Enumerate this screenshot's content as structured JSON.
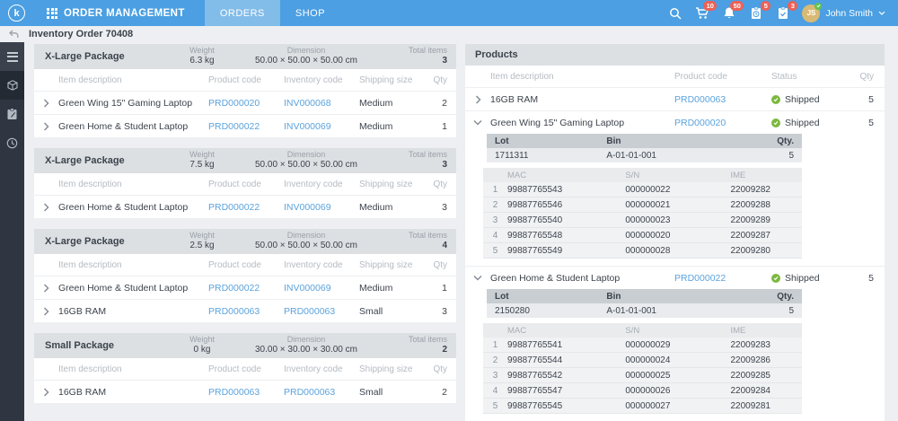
{
  "topbar": {
    "logo_text": "k",
    "app_title": "ORDER MANAGEMENT",
    "tabs": [
      {
        "label": "ORDERS"
      },
      {
        "label": "SHOP"
      }
    ],
    "badges": {
      "cart": "10",
      "notifications": "50",
      "tasks": "5",
      "approvals": "3"
    },
    "user": {
      "initials": "JS",
      "name": "John Smith"
    },
    "colors": {
      "bar": "#4b9fe2",
      "active_tab": "#82bce9",
      "badge": "#ec6156"
    }
  },
  "breadcrumb": {
    "title": "Inventory Order 70408"
  },
  "package_list": {
    "stat_labels": {
      "weight": "Weight",
      "dimension": "Dimension",
      "total_items": "Total items"
    },
    "columns": {
      "description": "Item description",
      "product_code": "Product code",
      "inventory_code": "Inventory code",
      "shipping_size": "Shipping size",
      "qty": "Qty"
    },
    "packages": [
      {
        "name": "X-Large Package",
        "weight": "6.3 kg",
        "dimension": "50.00 × 50.00 × 50.00 cm",
        "total_items": "3",
        "rows": [
          {
            "description": "Green Wing 15\" Gaming Laptop",
            "product_code": "PRD000020",
            "inventory_code": "INV000068",
            "shipping_size": "Medium",
            "qty": "2"
          },
          {
            "description": "Green Home & Student Laptop",
            "product_code": "PRD000022",
            "inventory_code": "INV000069",
            "shipping_size": "Medium",
            "qty": "1"
          }
        ]
      },
      {
        "name": "X-Large Package",
        "weight": "7.5 kg",
        "dimension": "50.00 × 50.00 × 50.00 cm",
        "total_items": "3",
        "rows": [
          {
            "description": "Green Home & Student Laptop",
            "product_code": "PRD000022",
            "inventory_code": "INV000069",
            "shipping_size": "Medium",
            "qty": "3"
          }
        ]
      },
      {
        "name": "X-Large Package",
        "weight": "2.5 kg",
        "dimension": "50.00 × 50.00 × 50.00 cm",
        "total_items": "4",
        "rows": [
          {
            "description": "Green Home & Student Laptop",
            "product_code": "PRD000022",
            "inventory_code": "INV000069",
            "shipping_size": "Medium",
            "qty": "1"
          },
          {
            "description": "16GB RAM",
            "product_code": "PRD000063",
            "inventory_code": "PRD000063",
            "shipping_size": "Small",
            "qty": "3"
          }
        ]
      },
      {
        "name": "Small Package",
        "weight": "0 kg",
        "dimension": "30.00 × 30.00 × 30.00 cm",
        "total_items": "2",
        "rows": [
          {
            "description": "16GB RAM",
            "product_code": "PRD000063",
            "inventory_code": "PRD000063",
            "shipping_size": "Small",
            "qty": "2"
          }
        ]
      }
    ]
  },
  "products": {
    "title": "Products",
    "columns": {
      "description": "Item description",
      "product_code": "Product code",
      "status": "Status",
      "qty": "Qty"
    },
    "lot_columns": {
      "lot": "Lot",
      "bin": "Bin",
      "qty": "Qty."
    },
    "serial_columns": {
      "mac": "MAC",
      "sn": "S/N",
      "ime": "IME"
    },
    "status_color": "#7cb93f",
    "rows": [
      {
        "description": "16GB RAM",
        "product_code": "PRD000063",
        "status": "Shipped",
        "qty": "5"
      },
      {
        "description": "Green Wing 15\" Gaming Laptop",
        "product_code": "PRD000020",
        "status": "Shipped",
        "qty": "5",
        "lot": {
          "lot": "1711311",
          "bin": "A-01-01-001",
          "qty": "5"
        },
        "serials": [
          {
            "idx": "1",
            "mac": "99887765543",
            "sn": "000000022",
            "ime": "22009282"
          },
          {
            "idx": "2",
            "mac": "99887765546",
            "sn": "000000021",
            "ime": "22009288"
          },
          {
            "idx": "3",
            "mac": "99887765540",
            "sn": "000000023",
            "ime": "22009289"
          },
          {
            "idx": "4",
            "mac": "99887765548",
            "sn": "000000020",
            "ime": "22009287"
          },
          {
            "idx": "5",
            "mac": "99887765549",
            "sn": "000000028",
            "ime": "22009280"
          }
        ]
      },
      {
        "description": "Green Home & Student Laptop",
        "product_code": "PRD000022",
        "status": "Shipped",
        "qty": "5",
        "lot": {
          "lot": "2150280",
          "bin": "A-01-01-001",
          "qty": "5"
        },
        "serials": [
          {
            "idx": "1",
            "mac": "99887765541",
            "sn": "000000029",
            "ime": "22009283"
          },
          {
            "idx": "2",
            "mac": "99887765544",
            "sn": "000000024",
            "ime": "22009286"
          },
          {
            "idx": "3",
            "mac": "99887765542",
            "sn": "000000025",
            "ime": "22009285"
          },
          {
            "idx": "4",
            "mac": "99887765547",
            "sn": "000000026",
            "ime": "22009284"
          },
          {
            "idx": "5",
            "mac": "99887765545",
            "sn": "000000027",
            "ime": "22009281"
          }
        ]
      }
    ]
  }
}
